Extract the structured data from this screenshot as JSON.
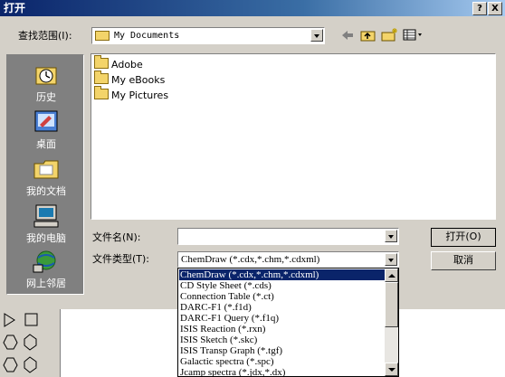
{
  "window": {
    "title": "打开",
    "help_btn": "?",
    "close_btn": "X"
  },
  "toolbar": {
    "lookin_label": "查找范围(I):",
    "lookin_value": "My Documents",
    "icons": [
      "back-icon",
      "up-folder-icon",
      "new-folder-icon",
      "view-menu-icon"
    ]
  },
  "places": [
    {
      "label": "历史",
      "icon": "history-icon"
    },
    {
      "label": "桌面",
      "icon": "desktop-icon"
    },
    {
      "label": "我的文档",
      "icon": "my-documents-icon"
    },
    {
      "label": "我的电脑",
      "icon": "my-computer-icon"
    },
    {
      "label": "网上邻居",
      "icon": "network-icon"
    }
  ],
  "files": [
    {
      "name": "Adobe",
      "icon": "folder-icon"
    },
    {
      "name": "My eBooks",
      "icon": "folder-icon"
    },
    {
      "name": "My Pictures",
      "icon": "folder-icon"
    }
  ],
  "filename": {
    "label": "文件名(N):",
    "value": ""
  },
  "filetype": {
    "label": "文件类型(T):",
    "value": "ChemDraw (*.cdx,*.chm,*.cdxml)",
    "options": [
      "ChemDraw (*.cdx,*.chm,*.cdxml)",
      "CD Style Sheet (*.cds)",
      "Connection Table (*.ct)",
      "DARC-F1 (*.f1d)",
      "DARC-F1 Query (*.f1q)",
      "ISIS Reaction (*.rxn)",
      "ISIS Sketch (*.skc)",
      "ISIS Transp Graph (*.tgf)",
      "Galactic spectra (*.spc)",
      "Jcamp spectra (*.jdx,*.dx)"
    ],
    "selected_index": 0
  },
  "buttons": {
    "open": "打开(O)",
    "cancel": "取消"
  },
  "colors": {
    "title_bar": "#0a246a",
    "selection": "#0a246a",
    "face": "#d4d0c8"
  }
}
